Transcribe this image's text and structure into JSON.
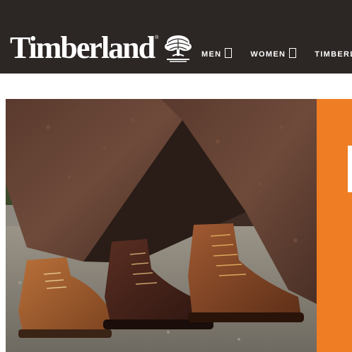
{
  "header": {
    "brand": "Timberland",
    "brand_mark": "®",
    "logo_icon": "tree-logo-icon",
    "background": "#2c2624"
  },
  "nav": {
    "items": [
      {
        "label": "MEN",
        "has_menu": true
      },
      {
        "label": "WOMEN",
        "has_menu": true
      },
      {
        "label": "TIMBERL",
        "has_menu": false
      }
    ]
  },
  "hero": {
    "image": "boots-on-gravel-under-rusted-metal-sculpture",
    "products": [
      "tan-suede-chukka-boot",
      "dark-brown-leather-boot",
      "brown-leather-lace-up-boot"
    ]
  },
  "promo": {
    "accent": "#ef7d24"
  }
}
